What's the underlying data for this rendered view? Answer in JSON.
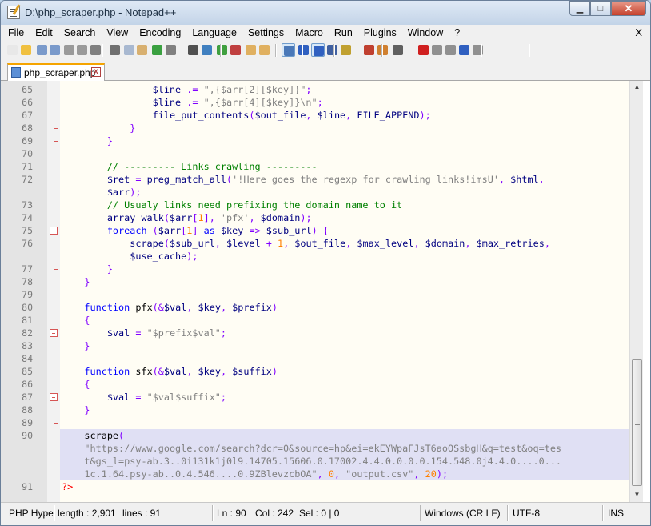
{
  "window": {
    "title": "D:\\php_scraper.php - Notepad++",
    "minimize": "▁",
    "maximize": "□",
    "close": "✕"
  },
  "menu": [
    "File",
    "Edit",
    "Search",
    "View",
    "Encoding",
    "Language",
    "Settings",
    "Macro",
    "Run",
    "Plugins",
    "Window",
    "?"
  ],
  "menu_close": "X",
  "toolbar": {
    "buttons": [
      {
        "name": "new-file-icon",
        "color": "#e8e8e8"
      },
      {
        "name": "open-file-icon",
        "color": "#f0c040"
      },
      {
        "name": "save-icon",
        "color": "#7a9acb"
      },
      {
        "name": "save-all-icon",
        "color": "#7a9acb"
      },
      {
        "name": "close-icon",
        "color": "#9a9a9a"
      },
      {
        "name": "close-all-icon",
        "color": "#9a9a9a"
      },
      {
        "name": "print-icon",
        "color": "#808080"
      },
      {
        "name": "cut-icon",
        "color": "#707070"
      },
      {
        "name": "copy-icon",
        "color": "#a8b8d0"
      },
      {
        "name": "paste-icon",
        "color": "#d8b070"
      },
      {
        "name": "undo-icon",
        "color": "#3aa040"
      },
      {
        "name": "redo-icon",
        "color": "#808080"
      },
      {
        "name": "find-icon",
        "color": "#505050"
      },
      {
        "name": "replace-icon",
        "color": "#4080c0"
      },
      {
        "name": "zoom-in-icon",
        "color": "#40a040"
      },
      {
        "name": "zoom-out-icon",
        "color": "#c04040"
      },
      {
        "name": "sync-vertical-icon",
        "color": "#e0b060"
      },
      {
        "name": "sync-horizontal-icon",
        "color": "#e0b060"
      },
      {
        "name": "word-wrap-icon",
        "color": "#4a78b8"
      },
      {
        "name": "show-all-chars-icon",
        "color": "#3060c0"
      },
      {
        "name": "indent-guide-icon",
        "color": "#3060c0"
      },
      {
        "name": "user-language-icon",
        "color": "#4060a0"
      },
      {
        "name": "doc-map-icon",
        "color": "#c0a030"
      },
      {
        "name": "function-list-icon",
        "color": "#c04030"
      },
      {
        "name": "folder-workspace-icon",
        "color": "#d08030"
      },
      {
        "name": "monitoring-icon",
        "color": "#606060"
      },
      {
        "name": "record-macro-icon",
        "color": "#d02020"
      },
      {
        "name": "stop-macro-icon",
        "color": "#909090"
      },
      {
        "name": "playback-macro-icon",
        "color": "#909090"
      },
      {
        "name": "run-macro-multiple-icon",
        "color": "#3060c0"
      },
      {
        "name": "save-macro-icon",
        "color": "#909090"
      }
    ]
  },
  "tab": {
    "label": "php_scraper.php",
    "close": "x"
  },
  "editor": {
    "lines": [
      {
        "n": "65",
        "tokens": [
          [
            "",
            "                "
          ],
          [
            "var",
            "$line"
          ],
          [
            "op",
            " .= "
          ],
          [
            "str",
            "\",{$arr[2][$key]}\""
          ],
          [
            "op",
            ";"
          ]
        ]
      },
      {
        "n": "66",
        "tokens": [
          [
            "",
            "                "
          ],
          [
            "var",
            "$line"
          ],
          [
            "op",
            " .= "
          ],
          [
            "str",
            "\",{$arr[4][$key]}\\n\""
          ],
          [
            "op",
            ";"
          ]
        ]
      },
      {
        "n": "67",
        "tokens": [
          [
            "",
            "                "
          ],
          [
            "fn",
            "file_put_contents"
          ],
          [
            "op",
            "("
          ],
          [
            "var",
            "$out_file"
          ],
          [
            "op",
            ", "
          ],
          [
            "var",
            "$line"
          ],
          [
            "op",
            ", "
          ],
          [
            "fn",
            "FILE_APPEND"
          ],
          [
            "op",
            ");"
          ]
        ]
      },
      {
        "n": "68",
        "tokens": [
          [
            "",
            "            "
          ],
          [
            "op",
            "}"
          ]
        ]
      },
      {
        "n": "69",
        "tokens": [
          [
            "",
            "        "
          ],
          [
            "op",
            "}"
          ]
        ]
      },
      {
        "n": "70",
        "tokens": []
      },
      {
        "n": "71",
        "tokens": [
          [
            "",
            "        "
          ],
          [
            "cmt",
            "// --------- Links crawling ---------"
          ]
        ]
      },
      {
        "n": "72",
        "tokens": [
          [
            "",
            "        "
          ],
          [
            "var",
            "$ret"
          ],
          [
            "op",
            " = "
          ],
          [
            "fn",
            "preg_match_all"
          ],
          [
            "op",
            "("
          ],
          [
            "str",
            "'!Here goes the regexp for crawling links!imsU'"
          ],
          [
            "op",
            ", "
          ],
          [
            "var",
            "$html"
          ],
          [
            "op",
            ","
          ]
        ]
      },
      {
        "n": "",
        "tokens": [
          [
            "",
            "        "
          ],
          [
            "var",
            "$arr"
          ],
          [
            "op",
            ");"
          ]
        ]
      },
      {
        "n": "73",
        "tokens": [
          [
            "",
            "        "
          ],
          [
            "cmt",
            "// Usualy links need prefixing the domain name to it"
          ]
        ]
      },
      {
        "n": "74",
        "tokens": [
          [
            "",
            "        "
          ],
          [
            "fn",
            "array_walk"
          ],
          [
            "op",
            "("
          ],
          [
            "var",
            "$arr"
          ],
          [
            "op",
            "["
          ],
          [
            "num",
            "1"
          ],
          [
            "op",
            "], "
          ],
          [
            "str",
            "'pfx'"
          ],
          [
            "op",
            ", "
          ],
          [
            "var",
            "$domain"
          ],
          [
            "op",
            ");"
          ]
        ]
      },
      {
        "n": "75",
        "tokens": [
          [
            "",
            "        "
          ],
          [
            "kw",
            "foreach"
          ],
          [
            "op",
            " ("
          ],
          [
            "var",
            "$arr"
          ],
          [
            "op",
            "["
          ],
          [
            "num",
            "1"
          ],
          [
            "op",
            "] "
          ],
          [
            "kw",
            "as"
          ],
          [
            "op",
            " "
          ],
          [
            "var",
            "$key"
          ],
          [
            "op",
            " => "
          ],
          [
            "var",
            "$sub_url"
          ],
          [
            "op",
            ") {"
          ]
        ]
      },
      {
        "n": "76",
        "tokens": [
          [
            "",
            "            "
          ],
          [
            "fn",
            "scrape"
          ],
          [
            "op",
            "("
          ],
          [
            "var",
            "$sub_url"
          ],
          [
            "op",
            ", "
          ],
          [
            "var",
            "$level"
          ],
          [
            "op",
            " + "
          ],
          [
            "num",
            "1"
          ],
          [
            "op",
            ", "
          ],
          [
            "var",
            "$out_file"
          ],
          [
            "op",
            ", "
          ],
          [
            "var",
            "$max_level"
          ],
          [
            "op",
            ", "
          ],
          [
            "var",
            "$domain"
          ],
          [
            "op",
            ", "
          ],
          [
            "var",
            "$max_retries"
          ],
          [
            "op",
            ","
          ]
        ]
      },
      {
        "n": "",
        "tokens": [
          [
            "",
            "            "
          ],
          [
            "var",
            "$use_cache"
          ],
          [
            "op",
            ");"
          ]
        ]
      },
      {
        "n": "77",
        "tokens": [
          [
            "",
            "        "
          ],
          [
            "op",
            "}"
          ]
        ]
      },
      {
        "n": "78",
        "tokens": [
          [
            "",
            "    "
          ],
          [
            "op",
            "}"
          ]
        ]
      },
      {
        "n": "79",
        "tokens": []
      },
      {
        "n": "80",
        "tokens": [
          [
            "",
            "    "
          ],
          [
            "kw",
            "function"
          ],
          [
            "op",
            " "
          ],
          [
            "",
            "pfx"
          ],
          [
            "op",
            "(&"
          ],
          [
            "var",
            "$val"
          ],
          [
            "op",
            ", "
          ],
          [
            "var",
            "$key"
          ],
          [
            "op",
            ", "
          ],
          [
            "var",
            "$prefix"
          ],
          [
            "op",
            ")"
          ]
        ]
      },
      {
        "n": "81",
        "tokens": [
          [
            "",
            "    "
          ],
          [
            "op",
            "{"
          ]
        ]
      },
      {
        "n": "82",
        "tokens": [
          [
            "",
            "        "
          ],
          [
            "var",
            "$val"
          ],
          [
            "op",
            " = "
          ],
          [
            "str",
            "\"$prefix$val\""
          ],
          [
            "op",
            ";"
          ]
        ]
      },
      {
        "n": "83",
        "tokens": [
          [
            "",
            "    "
          ],
          [
            "op",
            "}"
          ]
        ]
      },
      {
        "n": "84",
        "tokens": []
      },
      {
        "n": "85",
        "tokens": [
          [
            "",
            "    "
          ],
          [
            "kw",
            "function"
          ],
          [
            "op",
            " "
          ],
          [
            "",
            "sfx"
          ],
          [
            "op",
            "(&"
          ],
          [
            "var",
            "$val"
          ],
          [
            "op",
            ", "
          ],
          [
            "var",
            "$key"
          ],
          [
            "op",
            ", "
          ],
          [
            "var",
            "$suffix"
          ],
          [
            "op",
            ")"
          ]
        ]
      },
      {
        "n": "86",
        "tokens": [
          [
            "",
            "    "
          ],
          [
            "op",
            "{"
          ]
        ]
      },
      {
        "n": "87",
        "tokens": [
          [
            "",
            "        "
          ],
          [
            "var",
            "$val"
          ],
          [
            "op",
            " = "
          ],
          [
            "str",
            "\"$val$suffix\""
          ],
          [
            "op",
            ";"
          ]
        ]
      },
      {
        "n": "88",
        "tokens": [
          [
            "",
            "    "
          ],
          [
            "op",
            "}"
          ]
        ]
      },
      {
        "n": "89",
        "tokens": []
      },
      {
        "n": "90",
        "sel": true,
        "tokens": [
          [
            "",
            "    "
          ],
          [
            "",
            "scrape"
          ],
          [
            "op",
            "("
          ]
        ]
      },
      {
        "n": "",
        "sel": true,
        "tokens": [
          [
            "",
            "    "
          ],
          [
            "str",
            "\"https://www.google.com/search?dcr=0&source=hp&ei=ekEYWpaFJsT6aoOSsbgH&q=test&oq=tes"
          ]
        ]
      },
      {
        "n": "",
        "sel": true,
        "tokens": [
          [
            "",
            "    "
          ],
          [
            "str",
            "t&gs_l=psy-ab.3..0i131k1j0l9.14705.15606.0.17002.4.4.0.0.0.0.154.548.0j4.4.0....0..."
          ]
        ]
      },
      {
        "n": "",
        "sel": true,
        "tokens": [
          [
            "",
            "    "
          ],
          [
            "str",
            "1c.1.64.psy-ab..0.4.546....0.9ZBlevzcbOA\""
          ],
          [
            "op",
            ", "
          ],
          [
            "num",
            "0"
          ],
          [
            "op",
            ", "
          ],
          [
            "str",
            "\"output.csv\""
          ],
          [
            "op",
            ", "
          ],
          [
            "num",
            "20"
          ],
          [
            "op",
            ");"
          ]
        ]
      },
      {
        "n": "91",
        "tokens": [
          [
            "php",
            "?>"
          ]
        ]
      }
    ]
  },
  "status": {
    "language": "PHP Hype",
    "length": "length : 2,901",
    "lines": "lines : 91",
    "ln": "Ln : 90",
    "col": "Col : 242",
    "sel": "Sel : 0 | 0",
    "eol": "Windows (CR LF)",
    "encoding": "UTF-8",
    "mode": "INS"
  }
}
